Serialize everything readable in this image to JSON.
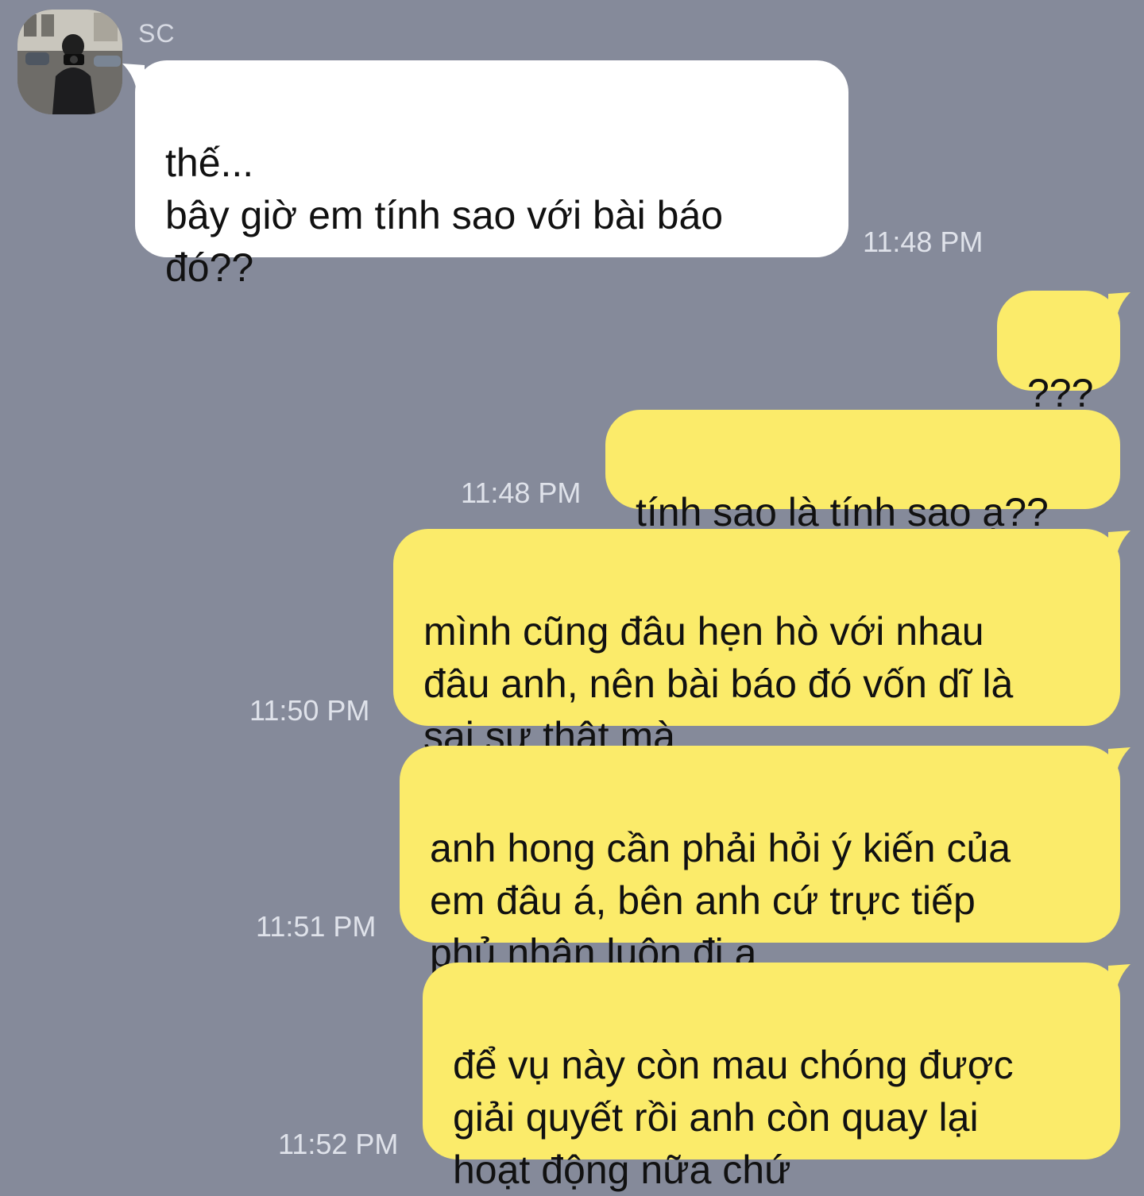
{
  "chat": {
    "sender_name": "SC",
    "colors": {
      "background": "#858a9a",
      "incoming_bubble": "#ffffff",
      "outgoing_bubble": "#fbeb6a",
      "timestamp": "#dfe2ea"
    },
    "messages": [
      {
        "direction": "incoming",
        "text": "thế...\nbây giờ em tính sao với bài báo\nđó??",
        "time": "11:48 PM"
      },
      {
        "direction": "outgoing",
        "text": "???",
        "time": ""
      },
      {
        "direction": "outgoing",
        "text": "tính sao là tính sao ạ??",
        "time": "11:48 PM"
      },
      {
        "direction": "outgoing",
        "text": "mình cũng đâu hẹn hò với nhau\nđâu anh, nên bài báo đó vốn dĩ là\nsai sự thật mà",
        "time": "11:50 PM"
      },
      {
        "direction": "outgoing",
        "text": "anh hong cần phải hỏi ý kiến của\nem đâu á, bên anh cứ trực tiếp\nphủ nhận luôn đi ạ",
        "time": "11:51 PM"
      },
      {
        "direction": "outgoing",
        "text": "để vụ này còn mau chóng được\ngiải quyết rồi anh còn quay lại\nhoạt động nữa chứ",
        "time": "11:52 PM"
      }
    ]
  }
}
